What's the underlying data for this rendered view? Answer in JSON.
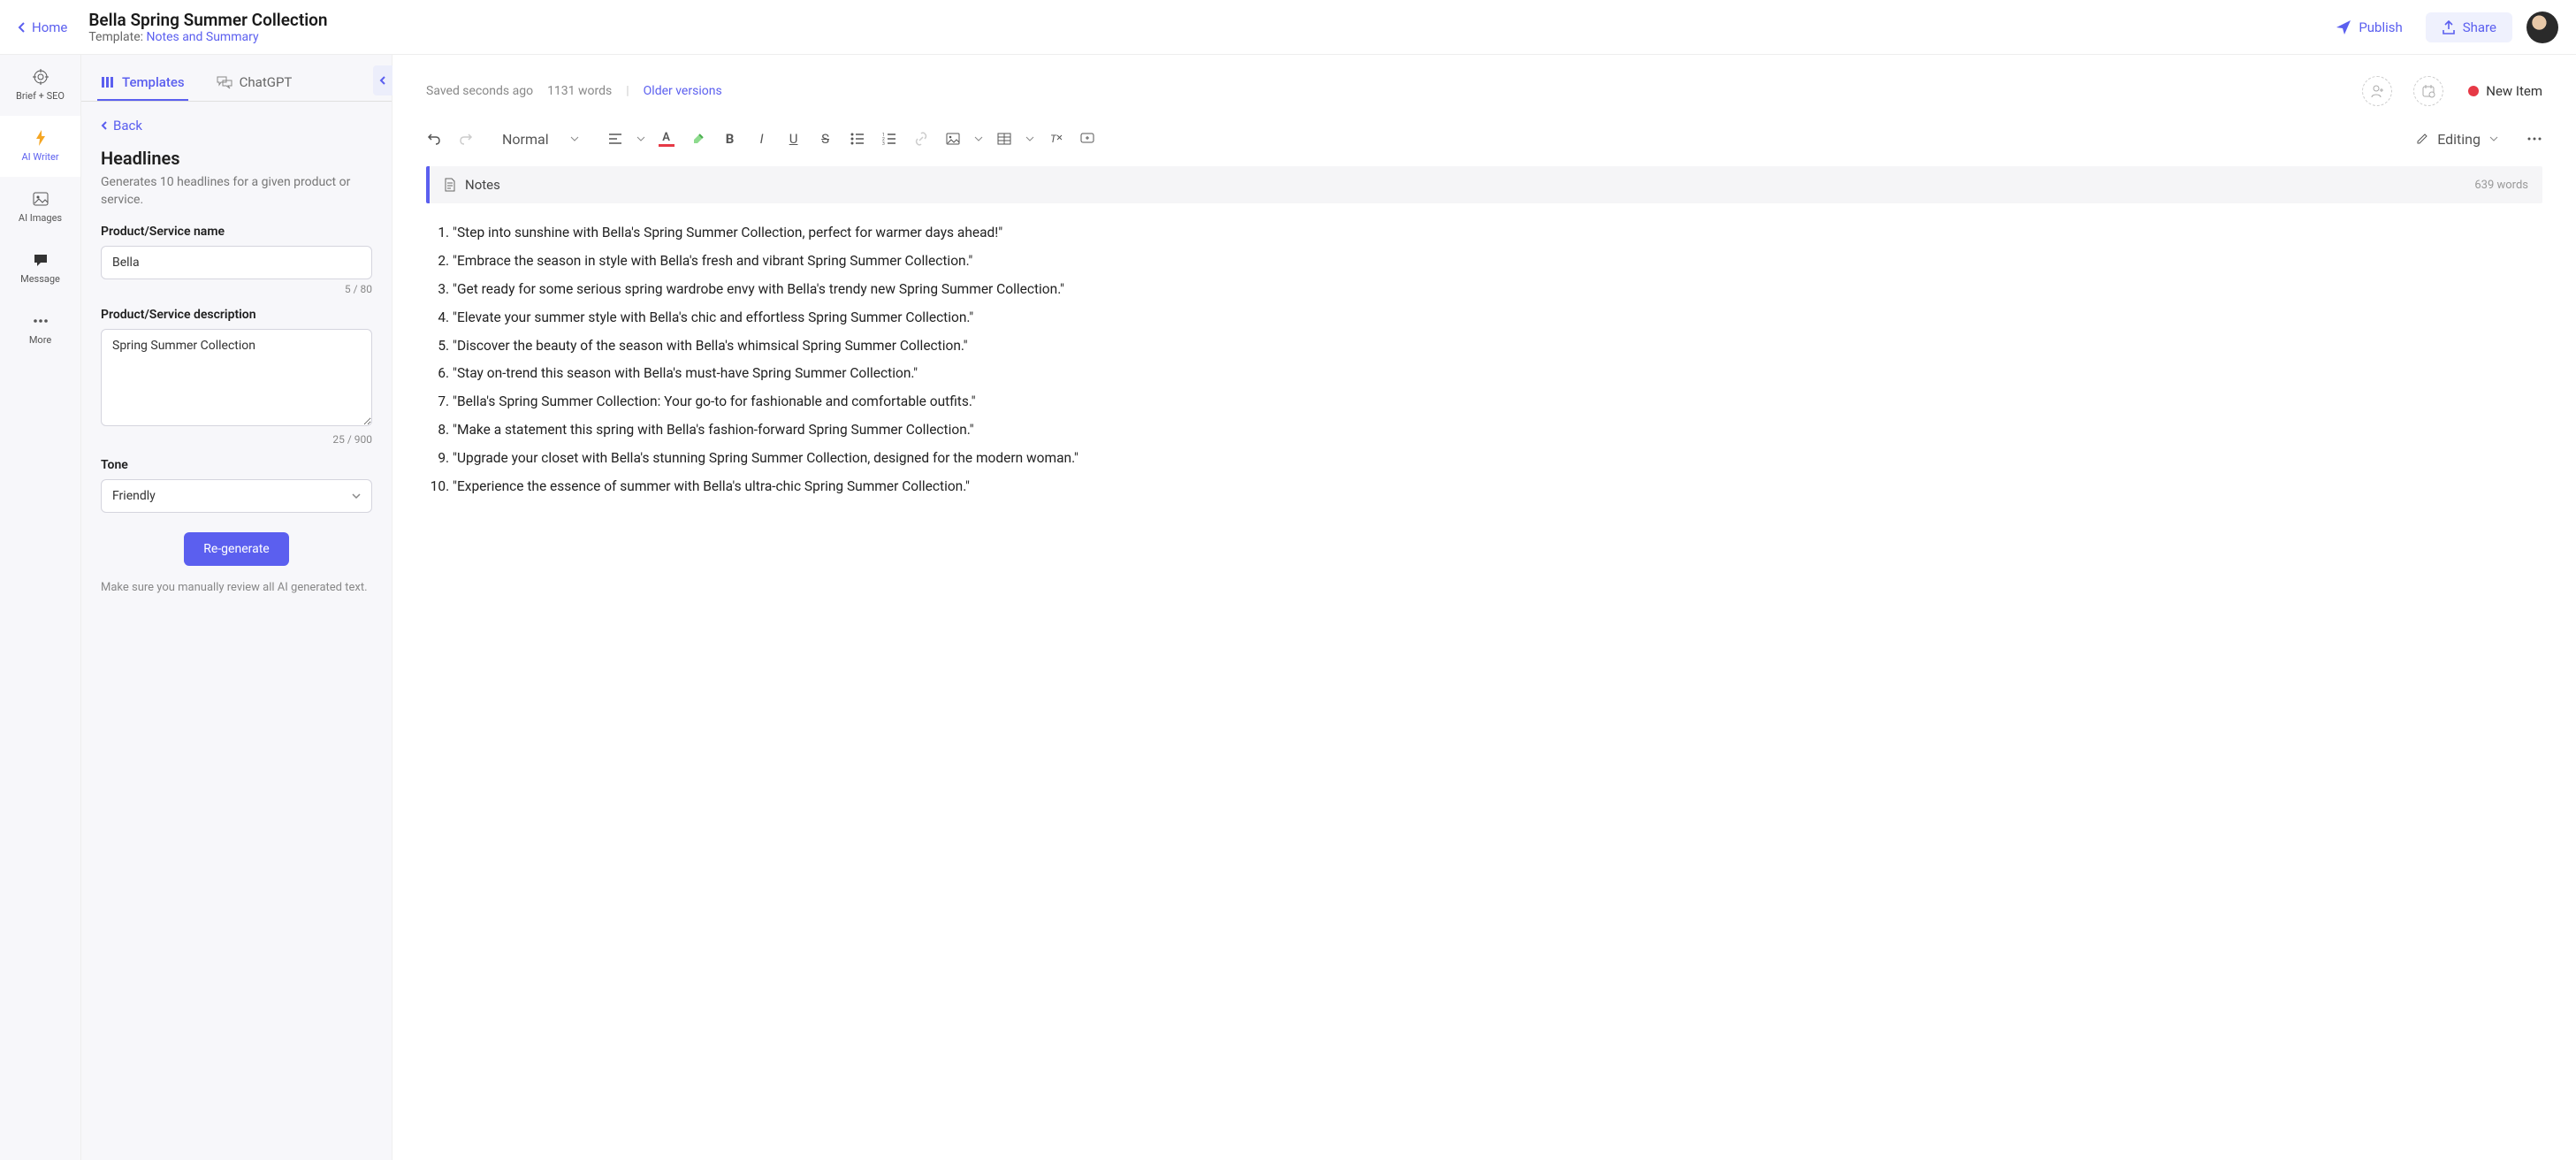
{
  "header": {
    "home": "Home",
    "title": "Bella Spring Summer Collection",
    "template_prefix": "Template: ",
    "template_name": "Notes and Summary",
    "publish": "Publish",
    "share": "Share"
  },
  "rail": {
    "brief": "Brief + SEO",
    "writer": "AI Writer",
    "images": "AI Images",
    "message": "Message",
    "more": "More"
  },
  "panel": {
    "tab_templates": "Templates",
    "tab_chatgpt": "ChatGPT",
    "back": "Back",
    "heading": "Headlines",
    "subheading": "Generates 10 headlines for a given product or service.",
    "name_label": "Product/Service name",
    "name_value": "Bella",
    "name_count": "5 / 80",
    "desc_label": "Product/Service description",
    "desc_value": "Spring Summer Collection",
    "desc_count": "25 / 900",
    "tone_label": "Tone",
    "tone_value": "Friendly",
    "regenerate": "Re-generate",
    "review_note": "Make sure you manually review all AI generated text."
  },
  "editor": {
    "saved": "Saved seconds ago",
    "word_count": "1131 words",
    "older": "Older versions",
    "new_item": "New Item",
    "style": "Normal",
    "mode": "Editing",
    "notes_label": "Notes",
    "notes_wc": "639 words"
  },
  "headlines": [
    "\"Step into sunshine with Bella's Spring Summer Collection, perfect for warmer days ahead!\"",
    "\"Embrace the season in style with Bella's fresh and vibrant Spring Summer Collection.\"",
    "\"Get ready for some serious spring wardrobe envy with Bella's trendy new Spring Summer Collection.\"",
    "\"Elevate your summer style with Bella's chic and effortless Spring Summer Collection.\"",
    "\"Discover the beauty of the season with Bella's whimsical Spring Summer Collection.\"",
    "\"Stay on-trend this season with Bella's must-have Spring Summer Collection.\"",
    "\"Bella's Spring Summer Collection: Your go-to for fashionable and comfortable outfits.\"",
    "\"Make a statement this spring with Bella's fashion-forward Spring Summer Collection.\"",
    "\"Upgrade your closet with Bella's stunning Spring Summer Collection, designed for the modern woman.\"",
    "\"Experience the essence of summer with Bella's ultra-chic Spring Summer Collection.\""
  ]
}
